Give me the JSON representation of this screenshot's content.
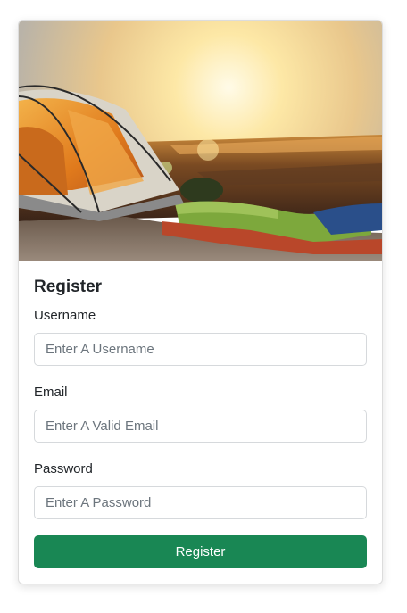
{
  "card": {
    "image_alt": "camping tent at sunset"
  },
  "form": {
    "title": "Register",
    "username": {
      "label": "Username",
      "placeholder": "Enter A Username",
      "value": ""
    },
    "email": {
      "label": "Email",
      "placeholder": "Enter A Valid Email",
      "value": ""
    },
    "password": {
      "label": "Password",
      "placeholder": "Enter A Password",
      "value": ""
    },
    "submit_label": "Register"
  },
  "colors": {
    "button_bg": "#198754",
    "button_text": "#ffffff",
    "input_border": "#d6d9dc",
    "text": "#212529",
    "placeholder": "#6c757d"
  }
}
